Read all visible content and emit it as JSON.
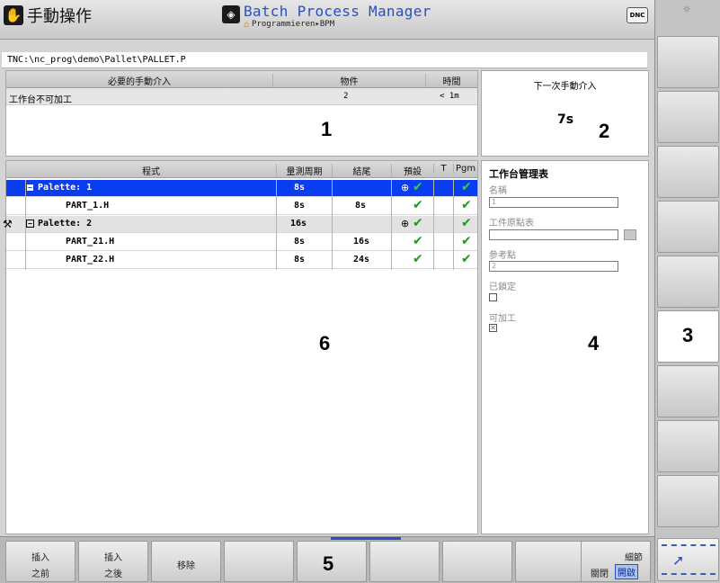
{
  "header": {
    "mode_title": "手動操作",
    "app_title": "Batch Process Manager",
    "breadcrumb": "Programmieren▸BPM",
    "dnc_label": "DNC"
  },
  "path": "TNC:\\nc_prog\\demo\\Pallet\\PALLET.P",
  "intervention_panel": {
    "headers": [
      "必要的手動介入",
      "物件",
      "時間"
    ],
    "rows": [
      {
        "label": "工作台不可加工",
        "object": "2",
        "time": "< 1m"
      }
    ]
  },
  "next_intervention": {
    "title": "下一次手動介入",
    "value": "7s"
  },
  "program_table": {
    "headers": [
      "程式",
      "量測周期",
      "結尾",
      "預設",
      "T",
      "Pgm"
    ],
    "rows": [
      {
        "name": "Palette: 1",
        "cycle": "8s",
        "end": "",
        "selected": true
      },
      {
        "name": "PART_1.H",
        "cycle": "8s",
        "end": "8s"
      },
      {
        "name": "Palette: 2",
        "cycle": "16s",
        "end": ""
      },
      {
        "name": "PART_21.H",
        "cycle": "8s",
        "end": "16s"
      },
      {
        "name": "PART_22.H",
        "cycle": "8s",
        "end": "24s"
      }
    ]
  },
  "pallet_form": {
    "title": "工作台管理表",
    "name_label": "名稱",
    "name_value": "1",
    "datum_table_label": "工件原點表",
    "datum_table_value": "",
    "reference_label": "參考點",
    "reference_value": "2",
    "locked_label": "已鎖定",
    "machinable_label": "可加工"
  },
  "bottom_softkeys": [
    {
      "line1": "插入",
      "line2": "之前"
    },
    {
      "line1": "插入",
      "line2": "之後"
    },
    {
      "line1": "移除",
      "line2": ""
    },
    {
      "line1": "",
      "line2": ""
    },
    {
      "line1": "",
      "line2": ""
    },
    {
      "line1": "",
      "line2": ""
    },
    {
      "line1": "",
      "line2": ""
    },
    {
      "line1": "",
      "line2": ""
    },
    {
      "line1": "細節",
      "off": "關閉",
      "on": "開啟"
    }
  ],
  "callouts": [
    "1",
    "2",
    "3",
    "4",
    "5",
    "6"
  ],
  "colors": {
    "selection": "#0a3cf0",
    "check": "#1d9a1d",
    "title_blue": "#2a4fc4"
  }
}
